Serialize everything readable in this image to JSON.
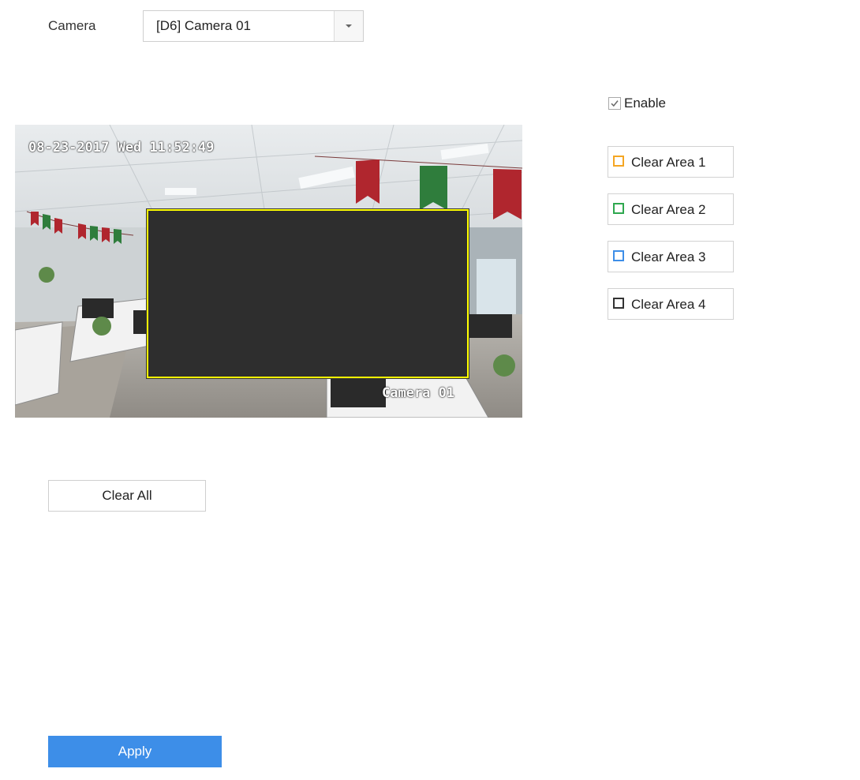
{
  "camera": {
    "label": "Camera",
    "selected": "[D6] Camera 01"
  },
  "enable": {
    "label": "Enable",
    "checked": true
  },
  "preview": {
    "osd_datetime": "08-23-2017 Wed 11:52:49",
    "osd_camera_name": "Camera 01",
    "mask_border_color": "#ffff00"
  },
  "clear_areas": [
    {
      "label": "Clear Area 1",
      "color": "#f5a623"
    },
    {
      "label": "Clear Area 2",
      "color": "#2fa84f"
    },
    {
      "label": "Clear Area 3",
      "color": "#3d8ee8"
    },
    {
      "label": "Clear Area 4",
      "color": "#333333"
    }
  ],
  "buttons": {
    "clear_all": "Clear All",
    "apply": "Apply"
  },
  "colors": {
    "accent": "#3d8ee8"
  }
}
